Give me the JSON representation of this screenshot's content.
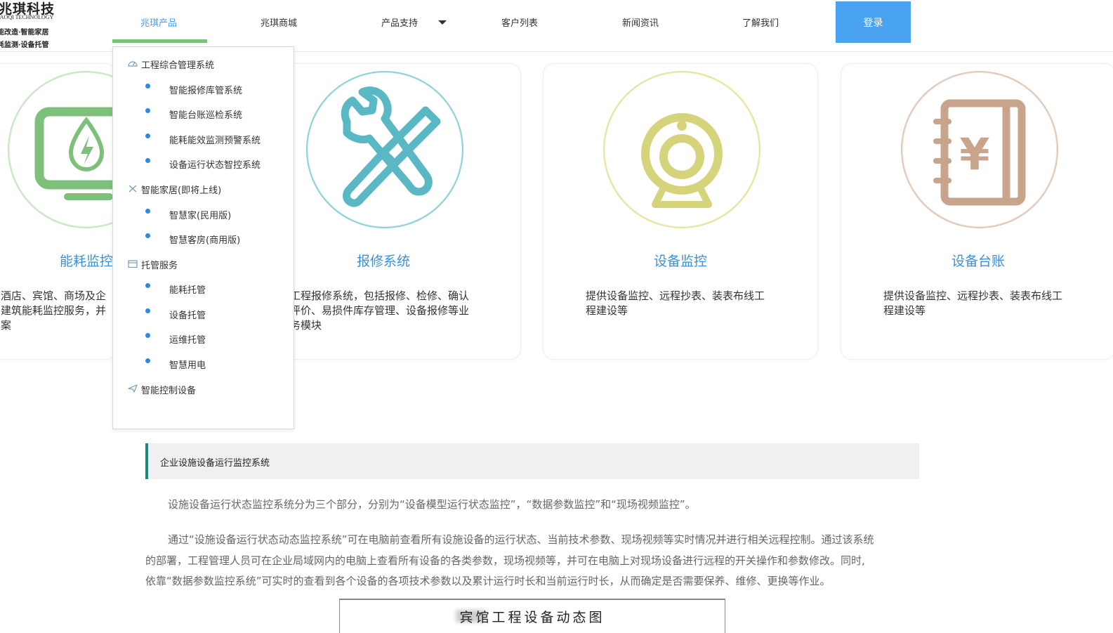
{
  "header": {
    "logo": {
      "title": "兆琪科技",
      "en": "HAOQI TECHNOLOGY",
      "slogan1": "能改造·智能家居",
      "slogan2": "耗监测·设备托管"
    },
    "nav": [
      {
        "label": "兆琪产品",
        "active": true
      },
      {
        "label": "兆琪商城"
      },
      {
        "label": "产品支持",
        "has_dropdown": true
      },
      {
        "label": "客户列表"
      },
      {
        "label": "新闻资讯"
      },
      {
        "label": "了解我们"
      }
    ],
    "login_label": "登录",
    "accent_color": "#4aa3f0",
    "active_underline_color": "#7cc07a"
  },
  "dropdown": {
    "categories": [
      {
        "label": "工程综合管理系统",
        "icon": "gauge-icon",
        "items": [
          "智能报修库管系统",
          "智能台账巡检系统",
          "能耗能效监测预警系统",
          "设备运行状态智控系统"
        ]
      },
      {
        "label": "智能家居(即将上线)",
        "icon": "tools-icon",
        "items": [
          "智慧家(民用版)",
          "智慧客房(商用版)"
        ]
      },
      {
        "label": "托管服务",
        "icon": "calendar-icon",
        "items": [
          "能耗托管",
          "设备托管",
          "运维托管",
          "智慧用电"
        ]
      },
      {
        "label": "智能控制设备",
        "icon": "send-icon",
        "items": []
      }
    ]
  },
  "cards": [
    {
      "title": "能耗监控",
      "icon": "energy-monitor-icon",
      "color": "#7cc07a",
      "desc": [
        "酒店、宾馆、商场及企",
        "建筑能耗监控服务，并",
        "案"
      ]
    },
    {
      "title": "报修系统",
      "icon": "wrench-screwdriver-icon",
      "color": "#5ab8c4",
      "desc": [
        "工程报修系统，包括报修、检修、确认",
        "评价、易损件库存管理、设备报修等业",
        "务模块"
      ]
    },
    {
      "title": "设备监控",
      "icon": "webcam-icon",
      "color": "#d6d47a",
      "desc": [
        "提供设备监控、远程抄表、装表布线工",
        "程建设等"
      ]
    },
    {
      "title": "设备台账",
      "icon": "ledger-icon",
      "color": "#c9a48c",
      "desc": [
        "提供设备监控、远程抄表、装表布线工",
        "程建设等"
      ]
    }
  ],
  "article": {
    "section_title": "企业设施设备运行监控系统",
    "accent_color": "#1a8a7a",
    "para1": "设施设备运行状态监控系统分为三个部分，分别为“设备模型运行状态监控”，“数据参数监控”和“现场视频监控”。",
    "para2_lines": [
      "通过“设施设备运行状态动态监控系统”可在电脑前查看所有设施设备的运行状态、当前技术参数、现场视频等实时情况并进行相关远程控制。通过该系统",
      "的部署，工程管理人员可在企业局域网内的电脑上查看所有设备的各类参数，现场视频等，并可在电脑上对现场设备进行远程的开关操作和参数修改。同时,",
      "依靠“数据参数监控系统”可实时的查看到各个设备的各项技术参数以及累计运行时长和当前运行时长，从而确定是否需要保养、维修、更换等作业。"
    ],
    "image_caption": "宾馆工程设备动态图"
  }
}
